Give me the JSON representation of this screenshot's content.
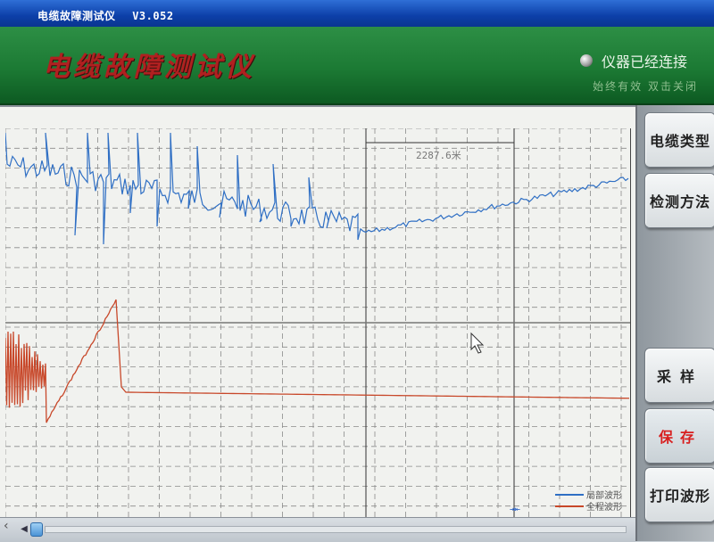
{
  "window": {
    "title": "电缆故障测试仪",
    "version": "V3.052"
  },
  "banner": {
    "app_title": "电缆故障测试仪",
    "connection_status": "仪器已经连接",
    "sub_status": "始终有效  双击关闭"
  },
  "plot": {
    "cursor_readout": "2287.6米",
    "marker": "⇥⇤"
  },
  "legend": {
    "local": {
      "label": "局部波形",
      "color": "#2f6fc4"
    },
    "global": {
      "label": "全程波形",
      "color": "#c8482a"
    }
  },
  "buttons": {
    "cable_type": "电缆类型",
    "detect_method": "检测方法",
    "sample": "采样",
    "save": "保存",
    "print_waveform": "打印波形"
  },
  "colors": {
    "banner_green": "#1c7a34",
    "title_red": "#b02020",
    "grid": "#7a7a7a"
  }
}
